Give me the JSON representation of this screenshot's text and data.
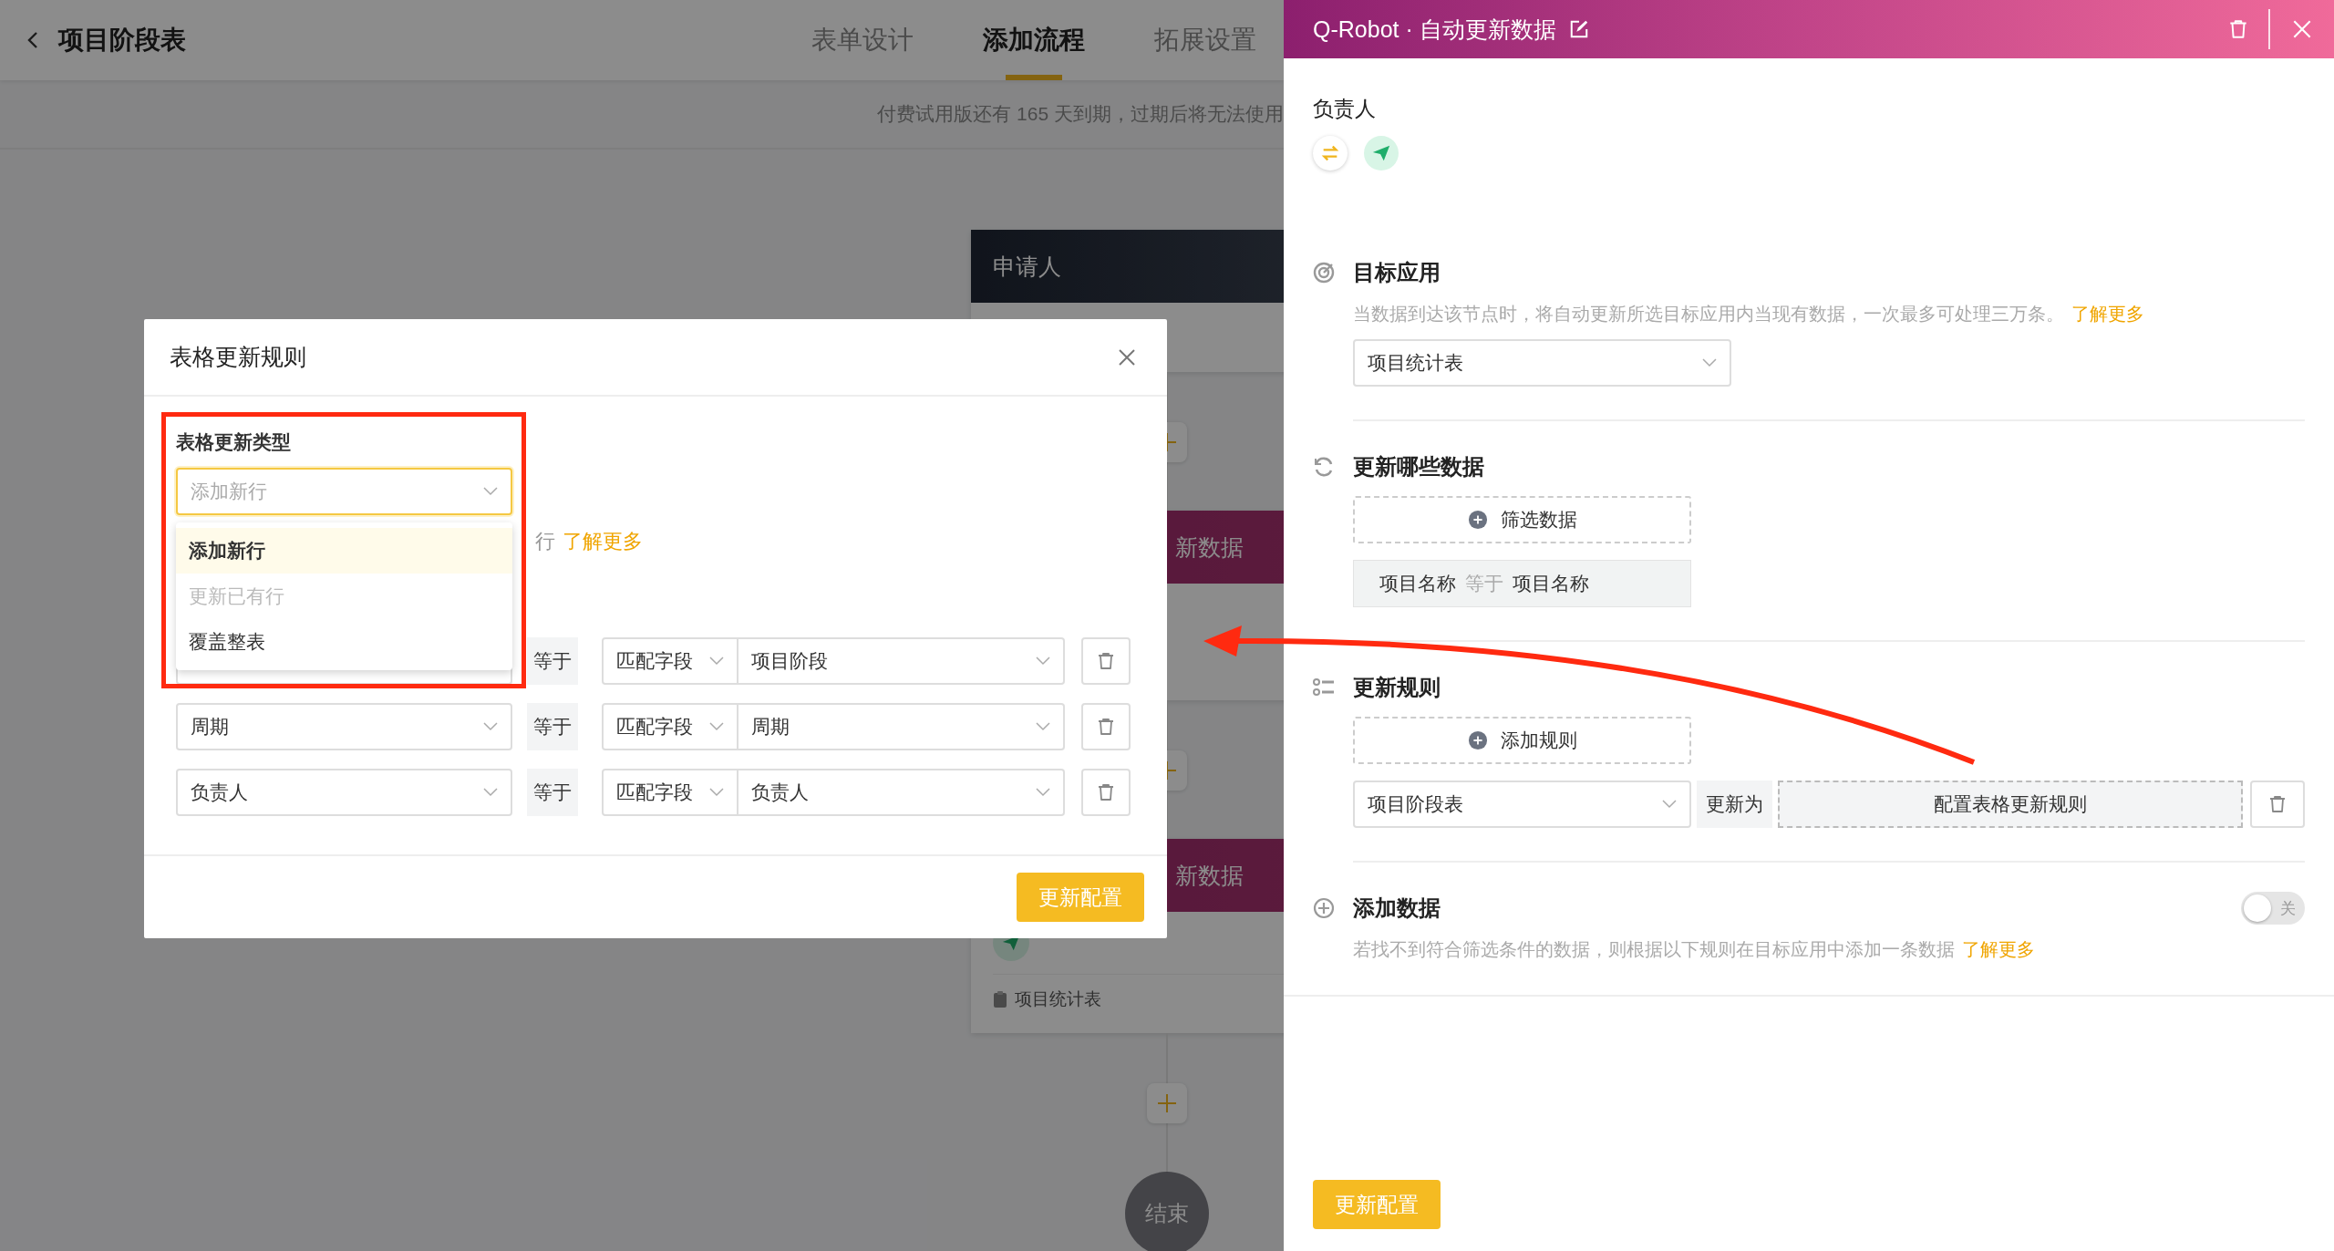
{
  "topbar": {
    "title": "项目阶段表",
    "tabs": [
      {
        "label": "表单设计",
        "selected": false
      },
      {
        "label": "添加流程",
        "selected": true
      },
      {
        "label": "拓展设置",
        "selected": false
      }
    ]
  },
  "notice": "付费试用版还有 165 天到期，过期后将无法使用",
  "flow": [
    {
      "kind": "start",
      "title": "申请人"
    },
    {
      "kind": "add"
    },
    {
      "kind": "robot",
      "title": "新数据"
    },
    {
      "kind": "add"
    },
    {
      "kind": "robot",
      "title": "新数据",
      "target": "项目统计表"
    },
    {
      "kind": "add"
    },
    {
      "kind": "end",
      "label": "结束"
    }
  ],
  "modal": {
    "title": "表格更新规则",
    "type_label": "表格更新类型",
    "type_select": {
      "placeholder": "添加新行",
      "focused": true
    },
    "options": [
      {
        "label": "添加新行",
        "selected": true,
        "disabled": false
      },
      {
        "label": "更新已有行",
        "selected": false,
        "disabled": true
      },
      {
        "label": "覆盖整表",
        "selected": false,
        "disabled": false
      }
    ],
    "description": "行",
    "link": "了解更多",
    "rows": [
      {
        "operator": "等于",
        "match": "匹配字段",
        "value": "项目阶段"
      },
      {
        "field": "周期",
        "operator": "等于",
        "match": "匹配字段",
        "value": "周期"
      },
      {
        "field": "负责人",
        "operator": "等于",
        "match": "匹配字段",
        "value": "负责人"
      }
    ],
    "submit": "更新配置"
  },
  "panel": {
    "title": "Q-Robot · 自动更新数据",
    "assignee_label": "负责人",
    "sections": [
      {
        "kind": "target",
        "title": "目标应用",
        "description": "当数据到达该节点时，将自动更新所选目标应用内当现有数据，一次最多可处理三万条。",
        "link": "了解更多",
        "select": "项目统计表"
      },
      {
        "kind": "filter",
        "title": "更新哪些数据",
        "add_button": "筛选数据",
        "condition": {
          "field": "项目名称",
          "operator": "等于",
          "value": "项目名称"
        }
      },
      {
        "kind": "rules",
        "title": "更新规则",
        "add_button": "添加规则",
        "rule": {
          "table": "项目阶段表",
          "action": "更新为",
          "config": "配置表格更新规则"
        }
      },
      {
        "kind": "add",
        "title": "添加数据",
        "toggle": {
          "on": false,
          "label": "关"
        },
        "description": "若找不到符合筛选条件的数据，则根据以下规则在目标应用中添加一条数据",
        "link": "了解更多"
      }
    ],
    "submit": "更新配置"
  }
}
